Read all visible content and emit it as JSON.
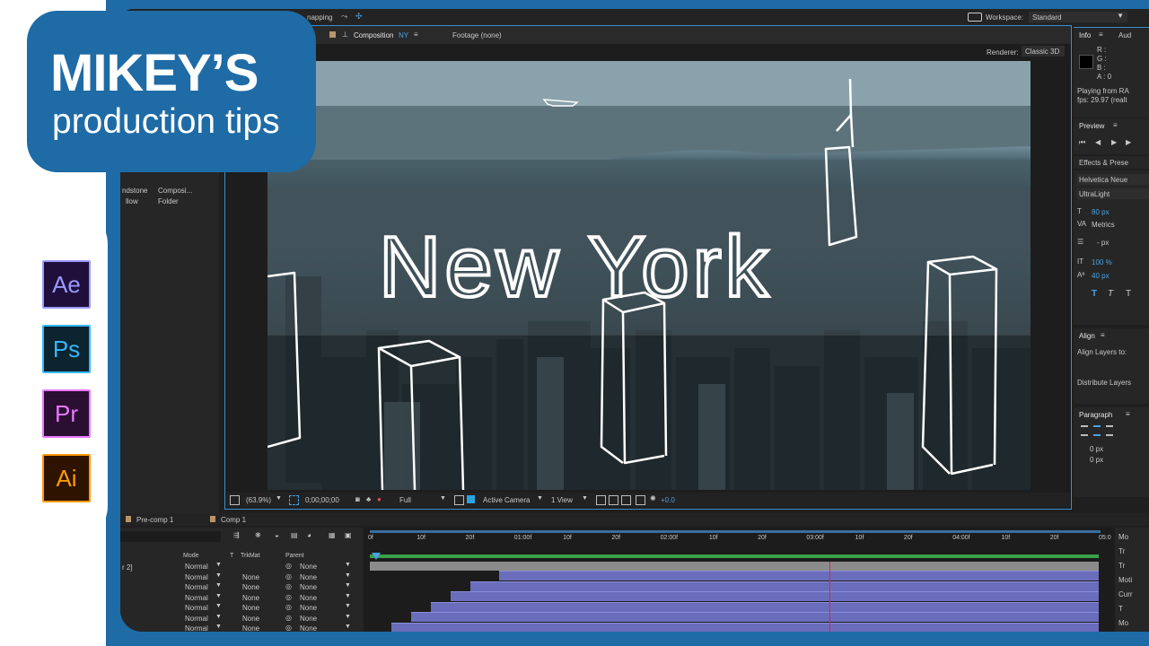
{
  "brand": {
    "title": "MIKEY’S",
    "subtitle": "production tips",
    "colors": {
      "frame": "#1e6ba6",
      "accent": "#3b8fd1"
    }
  },
  "app_icons": [
    {
      "label": "Ae",
      "fg": "#9999ff",
      "bg": "#1f0f3a",
      "border": "#9999ff"
    },
    {
      "label": "Ps",
      "fg": "#32b8ff",
      "bg": "#0c2330",
      "border": "#32b8ff"
    },
    {
      "label": "Pr",
      "fg": "#ea77ff",
      "bg": "#2a0f33",
      "border": "#ea77ff"
    },
    {
      "label": "Ai",
      "fg": "#ff9a00",
      "bg": "#2e1400",
      "border": "#ff9a00"
    }
  ],
  "topbar": {
    "snapping": "napping",
    "workspace_label": "Workspace:",
    "workspace_value": "Standard"
  },
  "comp_tabs": {
    "composition_label": "Composition",
    "composition_name": "NY",
    "footage_label": "Footage (none)"
  },
  "renderer": {
    "label": "Renderer:",
    "value": "Classic 3D"
  },
  "project_items": [
    {
      "name": "ndstone",
      "type": "Composi..."
    },
    {
      "name": "llow",
      "type": "Folder"
    }
  ],
  "viewer": {
    "overlay_text": "New York",
    "zoom": "(63.9%)",
    "timecode": "0;00;00;00",
    "resolution": "Full",
    "camera": "Active Camera",
    "views": "1 View",
    "exposure": "+0.0"
  },
  "info_panel": {
    "tab_info": "Info",
    "tab_audio": "Aud",
    "r": "R :",
    "g": "G :",
    "b": "B :",
    "a": "A : 0",
    "playing": "Playing from RA",
    "fps": "fps: 29.97 (realt"
  },
  "preview_panel": {
    "title": "Preview"
  },
  "effects_panel": {
    "title": "Effects & Prese"
  },
  "character_panel": {
    "font": "Helvetica Neue",
    "style": "UltraLight",
    "size": "80 px",
    "kerning": "Metrics",
    "leading": "- px",
    "scale": "100 %",
    "tracking": "40 px"
  },
  "align_panel": {
    "title": "Align",
    "align_to": "Align Layers to:",
    "distribute": "Distribute Layers"
  },
  "paragraph_panel": {
    "title": "Paragraph",
    "indent1": "0 px",
    "indent2": "0 px"
  },
  "timeline": {
    "tabs": [
      "Pre-comp 1",
      "Comp 1"
    ],
    "columns": {
      "mode": "Mode",
      "t": "T",
      "trkmat": "TrkMat",
      "parent": "Parent"
    },
    "first_layer_name": "r 2]",
    "rows": [
      {
        "mode": "Normal",
        "trkmat": "",
        "parent": "None"
      },
      {
        "mode": "Normal",
        "trkmat": "None",
        "parent": "None"
      },
      {
        "mode": "Normal",
        "trkmat": "None",
        "parent": "None"
      },
      {
        "mode": "Normal",
        "trkmat": "None",
        "parent": "None"
      },
      {
        "mode": "Normal",
        "trkmat": "None",
        "parent": "None"
      },
      {
        "mode": "Normal",
        "trkmat": "None",
        "parent": "None"
      },
      {
        "mode": "Normal",
        "trkmat": "None",
        "parent": "None"
      }
    ],
    "ruler": [
      "0f",
      "10f",
      "20f",
      "01:00f",
      "10f",
      "20f",
      "02:00f",
      "10f",
      "20f",
      "03:00f",
      "10f",
      "20f",
      "04:00f",
      "10f",
      "20f",
      "05:0"
    ],
    "right_labels": [
      "Mo",
      "Tr",
      "Tr",
      "Moti",
      "Curr",
      "T",
      "Mo"
    ]
  }
}
